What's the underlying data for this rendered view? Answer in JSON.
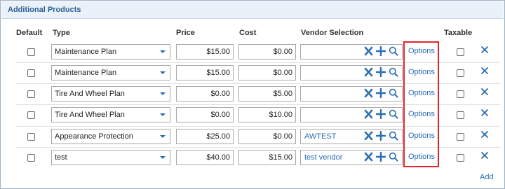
{
  "panel": {
    "title": "Additional Products"
  },
  "columns": {
    "default": "Default",
    "type": "Type",
    "price": "Price",
    "cost": "Cost",
    "vendor": "Vendor Selection",
    "taxable": "Taxable"
  },
  "rows": [
    {
      "type": "Maintenance Plan",
      "price": "$15.00",
      "cost": "$0.00",
      "vendor": "",
      "options": "Options",
      "default_checked": false,
      "taxable_checked": false
    },
    {
      "type": "Maintenance Plan",
      "price": "$15.00",
      "cost": "$0.00",
      "vendor": "",
      "options": "Options",
      "default_checked": false,
      "taxable_checked": false
    },
    {
      "type": "Tire And Wheel Plan",
      "price": "$0.00",
      "cost": "$5.00",
      "vendor": "",
      "options": "Options",
      "default_checked": false,
      "taxable_checked": false
    },
    {
      "type": "Tire And Wheel Plan",
      "price": "$0.00",
      "cost": "$10.00",
      "vendor": "",
      "options": "Options",
      "default_checked": false,
      "taxable_checked": false
    },
    {
      "type": "Appearance Protection",
      "price": "$25.00",
      "cost": "$0.00",
      "vendor": "AWTEST",
      "options": "Options",
      "default_checked": false,
      "taxable_checked": false
    },
    {
      "type": "test",
      "price": "$40.00",
      "cost": "$15.00",
      "vendor": "test vendor",
      "options": "Options",
      "default_checked": false,
      "taxable_checked": false
    }
  ],
  "footer": {
    "add_label": "Add"
  },
  "icons": {
    "clear": "close-x-icon",
    "add": "plus-icon",
    "search": "magnifier-icon",
    "delete": "delete-x-icon",
    "dropdown": "caret-down-icon"
  },
  "colors": {
    "accent": "#2a6eb5",
    "header_text": "#2a5f93",
    "header_bg": "#eaf1f8",
    "highlight": "#e0262c"
  }
}
